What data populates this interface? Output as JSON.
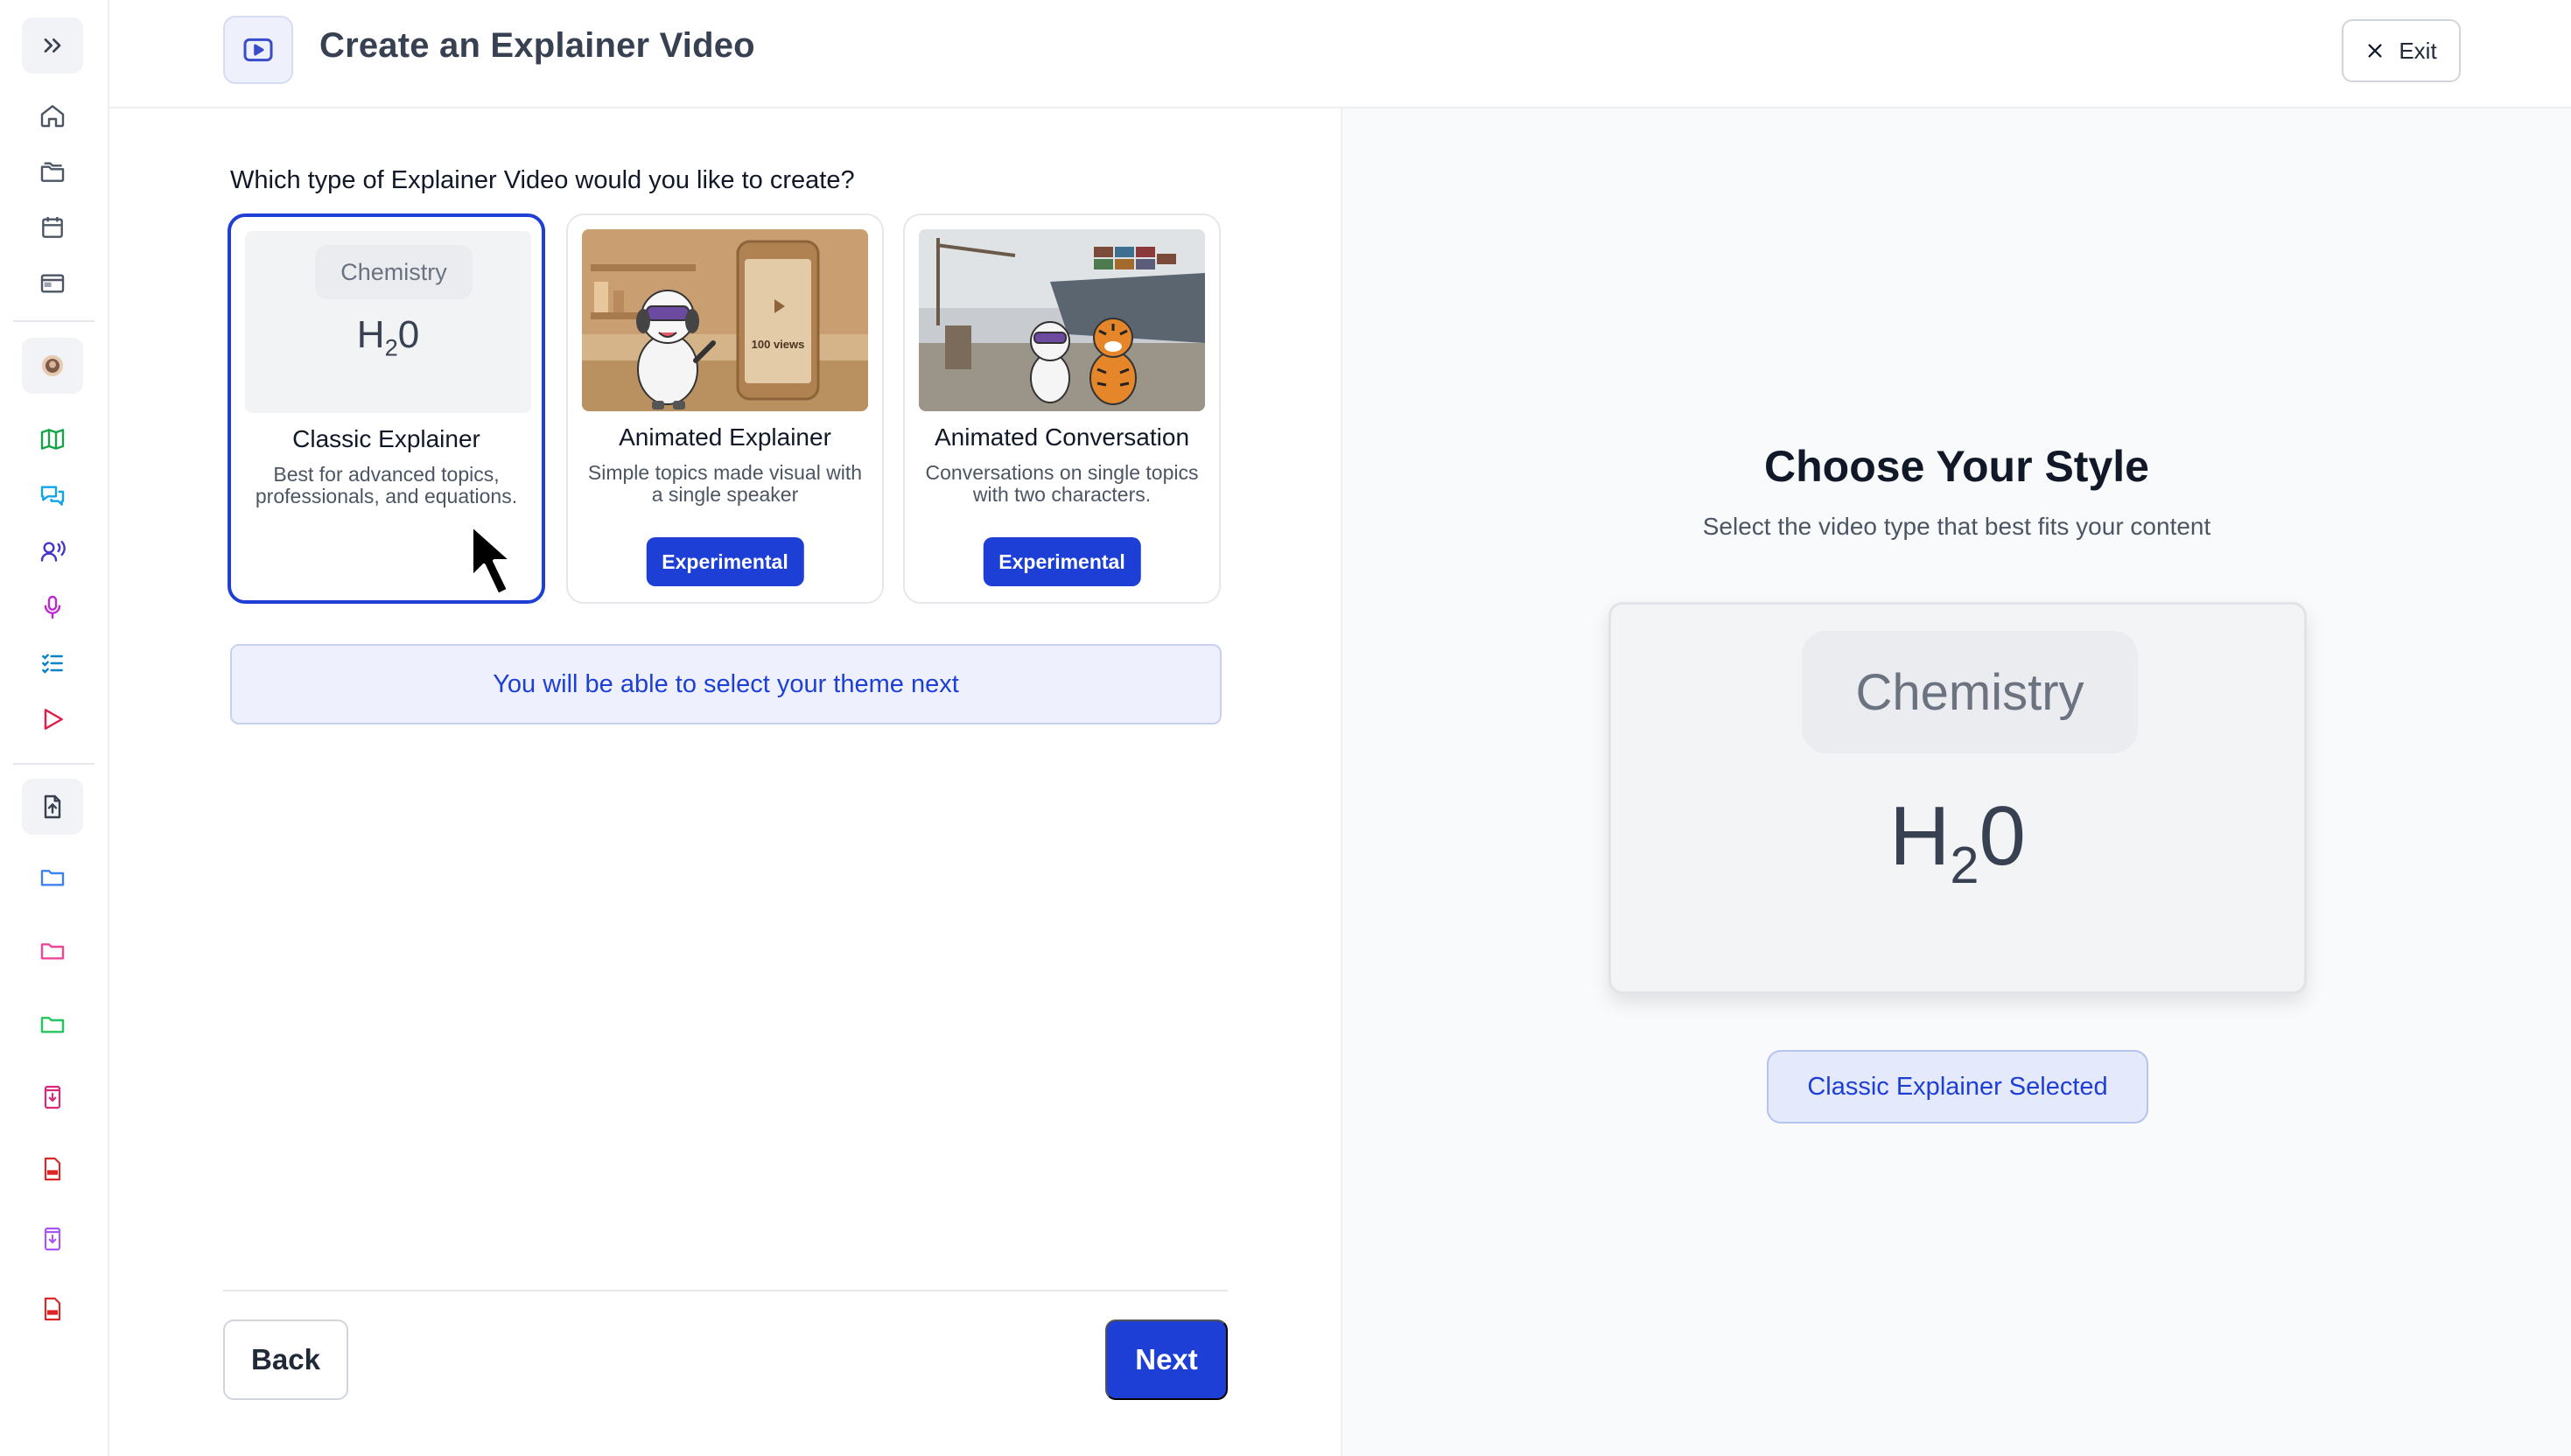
{
  "sidebar": {
    "icons": [
      "chevrons-right-icon",
      "home-icon",
      "folders-icon",
      "calendar-icon",
      "browser-window-icon",
      "avatar",
      "map-icon",
      "chat-bubbles-icon",
      "speaking-person-icon",
      "microphone-icon",
      "checklist-icon",
      "play-icon",
      "upload-file-icon",
      "folder-blue-icon",
      "folder-pink-icon",
      "folder-green-icon",
      "file-download-pink-icon",
      "pdf-file-icon",
      "file-download-purple-icon",
      "pdf-file-icon"
    ]
  },
  "header": {
    "title": "Create an Explainer Video",
    "exit_label": "Exit"
  },
  "main": {
    "question": "Which type of Explainer Video would you like to create?",
    "cards": [
      {
        "title": "Classic Explainer",
        "description": "Best for advanced topics, professionals, and equations.",
        "thumb_label": "Chemistry",
        "thumb_formula_main": "H",
        "thumb_formula_sub": "2",
        "thumb_formula_end": "0",
        "selected": true
      },
      {
        "title": "Animated Explainer",
        "description": "Simple topics made visual with a single speaker",
        "badge": "Experimental",
        "phone_text": "100 views"
      },
      {
        "title": "Animated Conversation",
        "description": "Conversations on single topics with two characters.",
        "badge": "Experimental"
      }
    ],
    "theme_note": "You will be able to select your theme next",
    "back_label": "Back",
    "next_label": "Next"
  },
  "preview": {
    "title": "Choose Your Style",
    "subtitle": "Select the video type that best fits your content",
    "label": "Chemistry",
    "formula_main": "H",
    "formula_sub": "2",
    "formula_end": "0",
    "selected_label": "Classic Explainer Selected"
  },
  "colors": {
    "accent": "#1d3fd6",
    "border": "#e5e7eb",
    "note_bg": "#eef1fd"
  }
}
